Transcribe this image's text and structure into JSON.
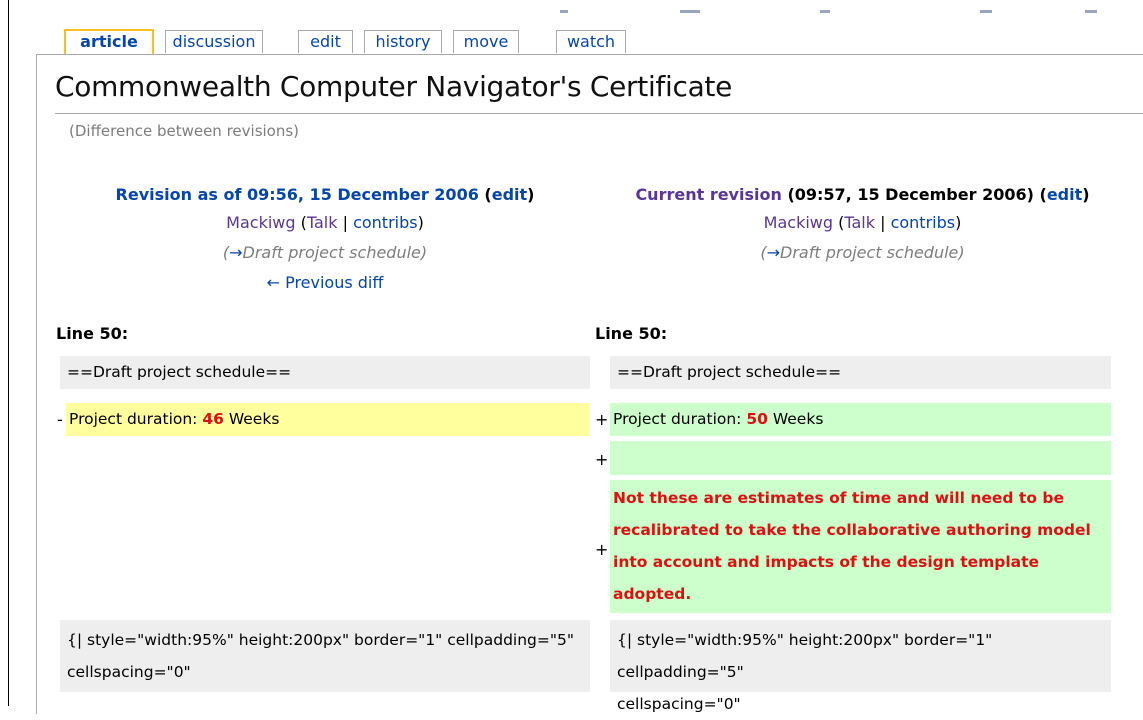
{
  "tabs": {
    "article": "article",
    "discussion": "discussion",
    "edit": "edit",
    "history": "history",
    "move": "move",
    "watch": "watch"
  },
  "page": {
    "title": "Commonwealth Computer Navigator's Certificate",
    "subtitle": "(Difference between revisions)"
  },
  "left_rev": {
    "heading": "Revision as of 09:56, 15 December 2006",
    "edit_open": "(",
    "edit_label": "edit",
    "edit_close": ")",
    "user": "Mackiwg",
    "talk_open": "(",
    "talk": "Talk",
    "sep": "|",
    "contribs": "contribs",
    "talk_close": ")",
    "summary_open": "(",
    "summary_arrow": "→",
    "summary": "Draft project schedule",
    "summary_close": ")",
    "prev_diff": "← Previous diff"
  },
  "right_rev": {
    "heading_link": "Current revision",
    "heading_rest": "(09:57, 15 December 2006)",
    "edit_open": "(",
    "edit_label": "edit",
    "edit_close": ")",
    "user": "Mackiwg",
    "talk_open": "(",
    "talk": "Talk",
    "sep": "|",
    "contribs": "contribs",
    "talk_close": ")",
    "summary_open": "(",
    "summary_arrow": "→",
    "summary": "Draft project schedule",
    "summary_close": ")"
  },
  "diff": {
    "line_label": "Line 50:",
    "context_1": "==Draft project schedule==",
    "minus": "-",
    "plus": "+",
    "removed_prefix": "Project duration: ",
    "removed_value": "46",
    "removed_suffix": " Weeks",
    "added_prefix": "Project duration: ",
    "added_value": "50",
    "added_suffix": " Weeks",
    "added_paragraph_l1": "Not these are estimates of time and will need to be",
    "added_paragraph_l2": "recalibrated to take the collaborative authoring model",
    "added_paragraph_l3": "into account and impacts of the design template",
    "added_paragraph_l4": "adopted.",
    "context_2_l1": "{| style=\"width:95%\" height:200px\" border=\"1\" cellpadding=\"5\"",
    "context_2_l2": "cellspacing=\"0\""
  },
  "colors": {
    "link": "#0645ad",
    "visited": "#5a3696",
    "deleted_bg": "#ffff9e",
    "added_bg": "#ccffcc",
    "context_bg": "#eeeeee",
    "change_text": "#dd1111"
  }
}
